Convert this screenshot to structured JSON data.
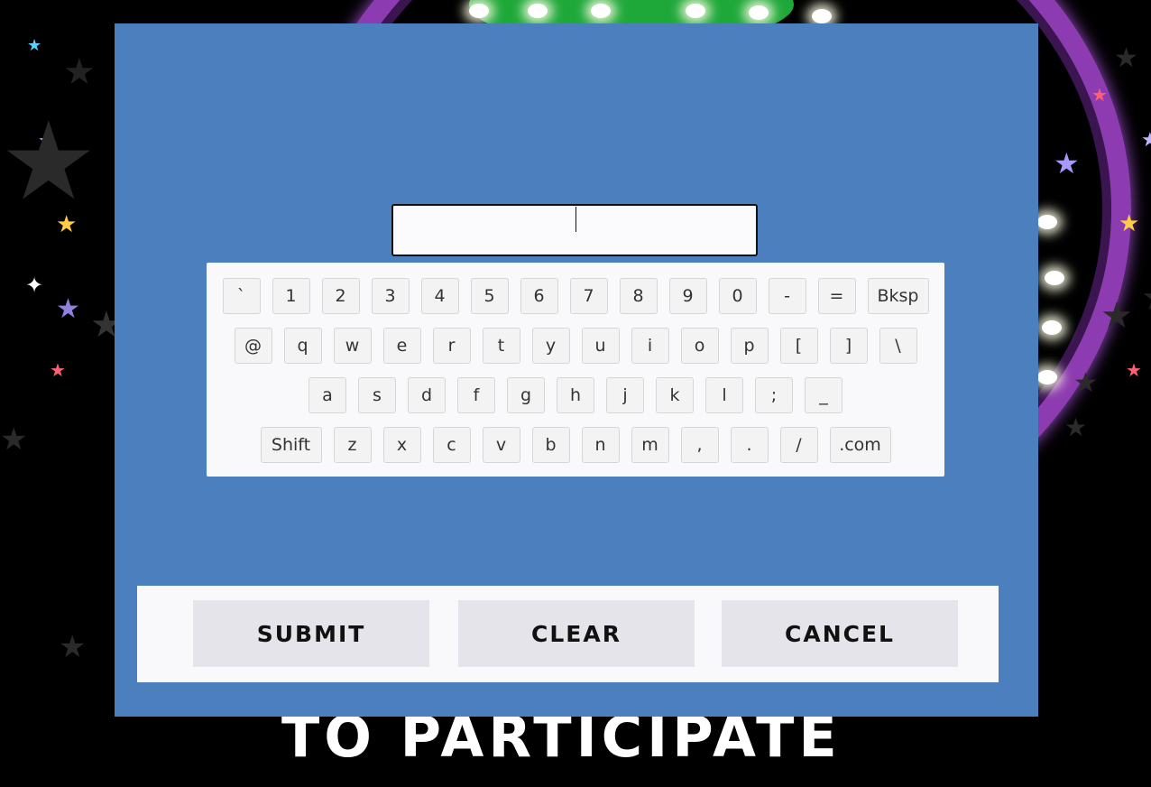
{
  "background": {
    "caption": "TO PARTICIPATE",
    "colors": {
      "backdrop": "#000000",
      "ring": "#8d3bb0",
      "ring_inner": "#1fa83a",
      "bulb": "#ffffff"
    }
  },
  "dialog": {
    "background_color": "#4c7fbd",
    "input": {
      "value": "",
      "placeholder": ""
    },
    "keyboard": {
      "rows": [
        [
          "`",
          "1",
          "2",
          "3",
          "4",
          "5",
          "6",
          "7",
          "8",
          "9",
          "0",
          "-",
          "=",
          "Bksp"
        ],
        [
          "@",
          "q",
          "w",
          "e",
          "r",
          "t",
          "y",
          "u",
          "i",
          "o",
          "p",
          "[",
          "]",
          "\\"
        ],
        [
          "a",
          "s",
          "d",
          "f",
          "g",
          "h",
          "j",
          "k",
          "l",
          ";",
          "_"
        ],
        [
          "Shift",
          "z",
          "x",
          "c",
          "v",
          "b",
          "n",
          "m",
          ",",
          ".",
          "/",
          ".com"
        ]
      ]
    },
    "actions": {
      "submit_label": "SUBMIT",
      "clear_label": "CLEAR",
      "cancel_label": "CANCEL"
    }
  }
}
